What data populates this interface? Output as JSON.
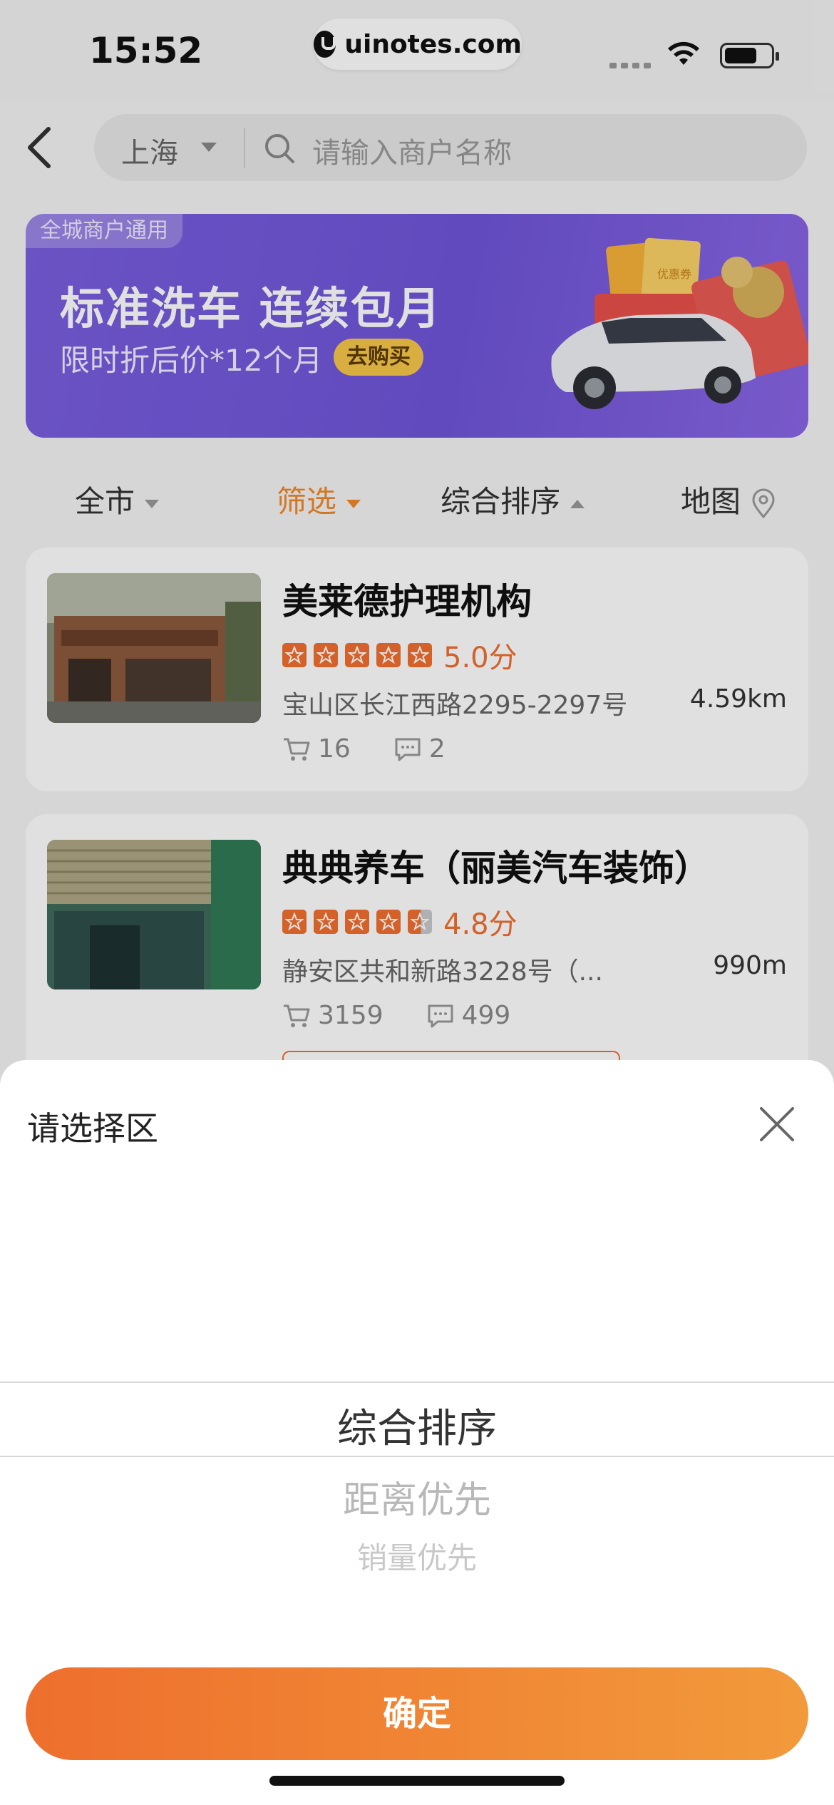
{
  "status_bar": {
    "time": "15:52",
    "watermark": "uinotes.com"
  },
  "search": {
    "city": "上海",
    "placeholder": "请输入商户名称"
  },
  "banner": {
    "tag": "全城商户通用",
    "title": "标准洗车 连续包月",
    "subtitle": "限时折后价*12个月",
    "button": "去购买",
    "art_text": "优惠券"
  },
  "filters": [
    {
      "label": "全市"
    },
    {
      "label": "筛选"
    },
    {
      "label": "综合排序"
    },
    {
      "label": "地图"
    }
  ],
  "merchants": [
    {
      "name": "美莱德护理机构",
      "rating": 5.0,
      "score": "5.0分",
      "address": "宝山区长江西路2295-2297号",
      "distance": "4.59km",
      "sales": "16",
      "comments": "2"
    },
    {
      "name": "典典养车（丽美汽车装饰）",
      "rating": 4.8,
      "score": "4.8分",
      "address": "静安区共和新路3228号（...",
      "distance": "990m",
      "sales": "3159",
      "comments": "499"
    }
  ],
  "sheet": {
    "title": "请选择区",
    "options": [
      "综合排序",
      "距离优先",
      "销量优先"
    ],
    "confirm": "确定"
  },
  "colors": {
    "accent": "#f0892a",
    "star": "#f26f2f",
    "banner": "#7a5fe0",
    "confirm_start": "#ee6f2d",
    "confirm_end": "#f29a3b"
  }
}
